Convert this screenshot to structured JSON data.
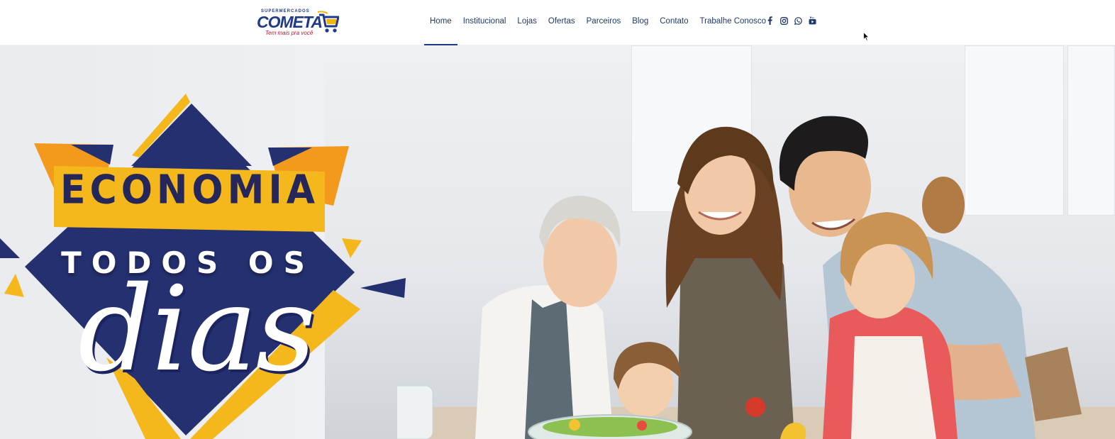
{
  "brand": {
    "top_line": "SUPERMERCADOS",
    "name": "COMETA",
    "tagline": "Tem mais pra você",
    "color_primary": "#1f3a8a",
    "color_accent": "#f5b400",
    "color_tag": "#c8102e"
  },
  "nav": {
    "items": [
      {
        "label": "Home",
        "active": true
      },
      {
        "label": "Institucional",
        "active": false
      },
      {
        "label": "Lojas",
        "active": false
      },
      {
        "label": "Ofertas",
        "active": false
      },
      {
        "label": "Parceiros",
        "active": false
      },
      {
        "label": "Blog",
        "active": false
      },
      {
        "label": "Contato",
        "active": false
      },
      {
        "label": "Trabalhe Conosco",
        "active": false
      }
    ]
  },
  "social": [
    {
      "icon": "facebook-icon"
    },
    {
      "icon": "instagram-icon"
    },
    {
      "icon": "whatsapp-icon"
    },
    {
      "icon": "youtube-icon"
    }
  ],
  "hero": {
    "line1": "ECONOMIA",
    "line2": "TODOS OS",
    "line3": "dias",
    "colors": {
      "navy": "#24306f",
      "yellow": "#f5b81c",
      "orange": "#f39a1c"
    }
  }
}
